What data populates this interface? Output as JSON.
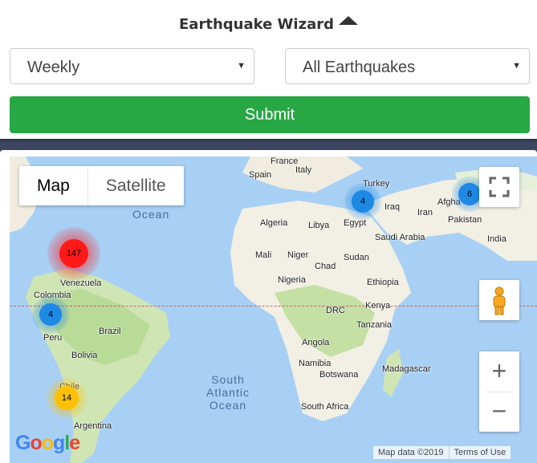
{
  "wizard": {
    "title": "Earthquake Wizard",
    "period": {
      "value": "Weekly"
    },
    "type": {
      "value": "All Earthquakes"
    },
    "submit_label": "Submit"
  },
  "map": {
    "map_type": {
      "map": "Map",
      "satellite": "Satellite"
    },
    "oceans": {
      "north": "Ocean",
      "south_atlantic": [
        "South",
        "Atlantic",
        "Ocean"
      ]
    },
    "labels": [
      "France",
      "Italy",
      "Spain",
      "Turkey",
      "Iraq",
      "Iran",
      "Afgha",
      "Pakistan",
      "India",
      "Algeria",
      "Libya",
      "Egypt",
      "Saudi Arabia",
      "Mali",
      "Niger",
      "Chad",
      "Sudan",
      "Nigeria",
      "Ethiopia",
      "Kenya",
      "DRC",
      "Tanzania",
      "Angola",
      "Namibia",
      "Botswana",
      "Madagascar",
      "South Africa",
      "Venezuela",
      "Colombia",
      "Peru",
      "Brazil",
      "Bolivia",
      "Chile",
      "Argentina"
    ],
    "clusters": [
      {
        "id": "caribbean",
        "count": "147",
        "color": "#ff1a1a"
      },
      {
        "id": "ecuador",
        "count": "4",
        "color": "#1e88e5"
      },
      {
        "id": "chile",
        "count": "14",
        "color": "#ffc107"
      },
      {
        "id": "eastern-med",
        "count": "4",
        "color": "#1e88e5"
      },
      {
        "id": "afghanistan",
        "count": "6",
        "color": "#1e88e5"
      }
    ],
    "google_logo": "Google",
    "attribution": {
      "data": "Map data ©2019",
      "terms": "Terms of Use"
    }
  },
  "icons": [
    "caret-up-icon",
    "dropdown-arrow-icon",
    "fullscreen-icon",
    "pegman-icon",
    "zoom-in-icon",
    "zoom-out-icon"
  ],
  "colors": {
    "submit": "#28a745",
    "water": "#a8d0f5",
    "land": "#f2efe4"
  }
}
